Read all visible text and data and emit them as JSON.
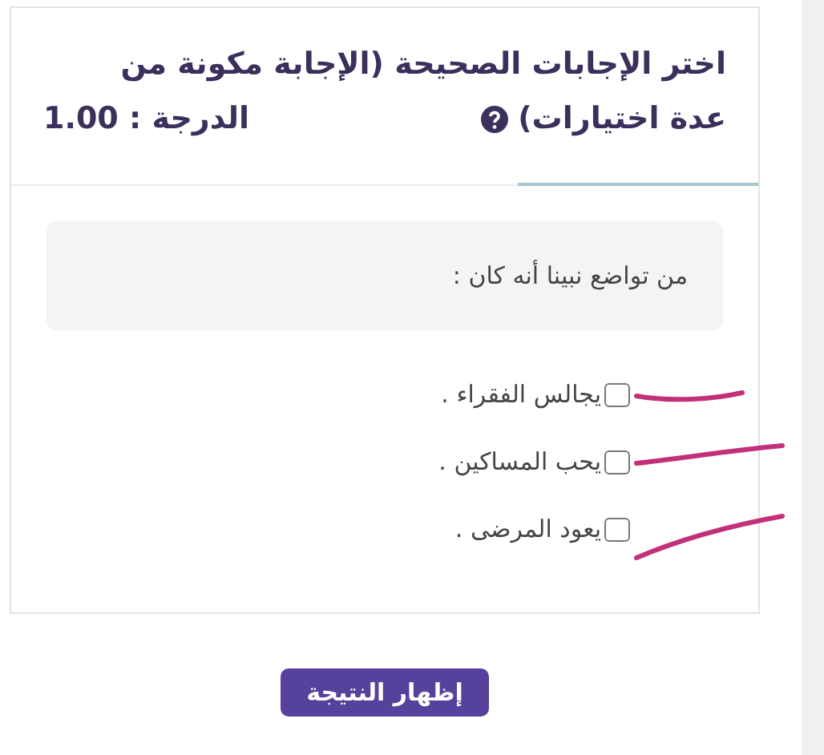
{
  "question": {
    "title_line_1": "اختر الإجابات الصحيحة (الإجابة مكونة من",
    "title_line_2": "عدة اختيارات)",
    "grade": "الدرجة : 1.00",
    "prompt": "من تواضع نبينا أنه كان :",
    "options": [
      {
        "label": "يجالس الفقراء .",
        "checked": false
      },
      {
        "label": "يحب المساكين .",
        "checked": false
      },
      {
        "label": "يعود المرضى .",
        "checked": false
      }
    ]
  },
  "button": {
    "label": "إظهار النتيجة"
  }
}
